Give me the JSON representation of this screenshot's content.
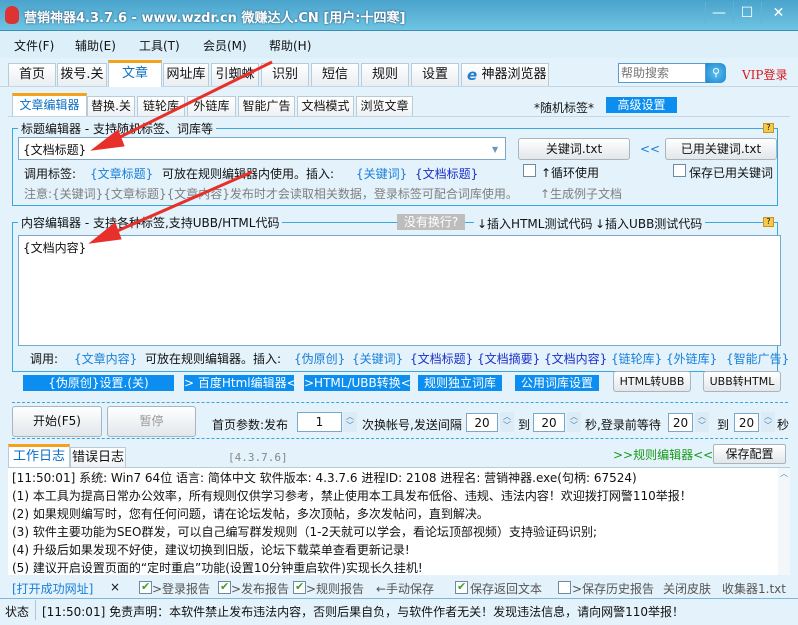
{
  "window": {
    "title": "营销神器4.3.7.6 - www.wzdr.cn 微赚达人.CN [用户:十四寒]",
    "minimize": "—",
    "maximize": "☐",
    "close": "✕"
  },
  "menu": [
    "文件(F)",
    "辅助(E)",
    "工具(T)",
    "会员(M)",
    "帮助(H)"
  ],
  "tabs": [
    "首页",
    "拨号.关",
    "文章",
    "网址库",
    "引蜘蛛",
    "识别",
    "短信",
    "规则",
    "设置",
    "神器浏览器"
  ],
  "search": {
    "placeholder": "帮助搜索"
  },
  "vip_login": "VIP登录",
  "subtabs": [
    "文章编辑器",
    "替换.关",
    "链轮库",
    "外链库",
    "智能广告",
    "文档模式",
    "浏览文章"
  ],
  "random_tag": "*随机标签*",
  "advanced": "高级设置",
  "title_editor": {
    "legend": "标题编辑器 - 支持随机标签、词库等",
    "value": "{文档标题}",
    "keyword_btn": "关键词.txt",
    "arrows": "<<",
    "used_keyword_btn": "已用关键词.txt",
    "call_label": "调用标签:",
    "call_tag": "{文章标题}",
    "call_desc": "可放在规则编辑器内使用。插入:",
    "insert1": "{关键词}",
    "insert2": "{文档标题}",
    "loop_use": "↑循环使用",
    "save_used": "保存已用关键词",
    "note": "注意:{关键词}{文章标题}{文章内容}发布时才会读取相关数据，登录标签可配合词库使用。",
    "gen_sample": "↑生成例子文档"
  },
  "content_editor": {
    "legend": "内容编辑器 - 支持各种标签,支持UBB/HTML代码",
    "no_wrap": "没有换行?",
    "insert_html": "↓插入HTML测试代码",
    "insert_ubb": "↓插入UBB测试代码",
    "value": "{文档内容}",
    "call_label": "调用:",
    "call_tag": "{文章内容}",
    "call_desc": "可放在规则编辑器。插入:",
    "tags": [
      "{伪原创}",
      "{关键词}",
      "{文档标题}",
      "{文档摘要}",
      "{文档内容}",
      "{链轮库}",
      "{外链库}",
      "{智能广告}"
    ],
    "buttons": [
      "{伪原创}设置.(关)",
      "> 百度Html编辑器<",
      ">HTML/UBB转换<",
      "规则独立词库",
      "公用词库设置"
    ],
    "html2ubb": "HTML转UBB",
    "ubb2html": "UBB转HTML"
  },
  "controls": {
    "start": "开始(F5)",
    "pause": "暂停",
    "home_param": "首页参数:发布",
    "publish_count": "1",
    "switch_label": "次换帐号,发送间隔",
    "interval_from": "20",
    "to1": "到",
    "interval_to": "20",
    "login_wait": "秒,登录前等待",
    "wait_from": "20",
    "to2": "到",
    "wait_to": "20",
    "sec": "秒"
  },
  "log": {
    "tabs": [
      "工作日志",
      "错误日志"
    ],
    "version": "[4.3.7.6]",
    "rule_editor": ">>规则编辑器<<",
    "save_config": "保存配置",
    "lines": [
      "[11:50:01] 系统: Win7 64位 语言: 简体中文 软件版本: 4.3.7.6 进程ID: 2108 进程名: 营销神器.exe(句柄: 67524)",
      "(1) 本工具为提高日常办公效率，所有规则仅供学习参考，禁止使用本工具发布低俗、违规、违法内容！欢迎拨打网警110举报！",
      "(2) 如果规则编写时，您有任何问题，请在论坛发帖，多次顶帖，多次发帖问，直到解决。",
      "(3) 软件主要功能为SEO群发，可以自己编写群发规则（1-2天就可以学会，看论坛顶部视频）支持验证码识别;",
      "(4) 升级后如果发现不好使，建议切换到旧版，论坛下载菜单查看更新记录!",
      "(5) 建议开启设置页面的“定时重启”功能(设置10分钟重启软件)实现长久挂机!"
    ]
  },
  "bottom": {
    "open_url": "[打开成功网址]",
    "close": "×",
    "login_report": ">登录报告",
    "publish_report": ">发布报告",
    "rule_report": ">规则报告",
    "manual_save": "←手动保存",
    "save_return": "保存返回文本",
    "save_history": ">保存历史报告",
    "close_skin": "关闭皮肤",
    "collector": "收集器1.txt",
    "checks": {
      "login_report": true,
      "publish_report": true,
      "rule_report": true,
      "save_return": true,
      "save_history": false
    }
  },
  "status": {
    "label": "状态",
    "text": "[11:50:01] 免责声明：本软件禁止发布违法内容，否则后果自负，与软件作者无关！发现违法信息，请向网警110举报！"
  },
  "colors": {
    "accent": "#0b8ef0",
    "link": "#1a7fd8",
    "annotation_arrow": "#e8302a"
  }
}
